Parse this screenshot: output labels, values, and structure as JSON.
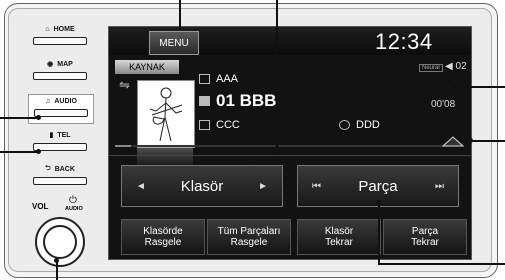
{
  "left_panel": {
    "home": "HOME",
    "map": "MAP",
    "audio": "AUDIO",
    "tel": "TEL",
    "back": "BACK",
    "vol": "VOL",
    "audio_small": "AUDIO"
  },
  "screen": {
    "menu_label": "MENU",
    "clock": "12:34",
    "source_label": "KAYNAK",
    "neural": "Neural",
    "channel": "02",
    "elapsed": "00'08",
    "track_list": {
      "folder": "AAA",
      "track": "01 BBB",
      "artist": "CCC",
      "album": "DDD"
    },
    "progress_fraction": 0.05,
    "folder_control": {
      "label": "Klasör",
      "prev": "◄",
      "next": "►"
    },
    "track_control": {
      "label": "Parça",
      "prev": "⏮",
      "next": "⏭"
    },
    "soft_buttons": [
      {
        "line1": "Klasörde",
        "line2": "Rasgele"
      },
      {
        "line1": "Tüm Parçaları",
        "line2": "Rasgele"
      },
      {
        "line1": "Klasör",
        "line2": "Tekrar"
      },
      {
        "line1": "Parça",
        "line2": "Tekrar"
      }
    ]
  }
}
